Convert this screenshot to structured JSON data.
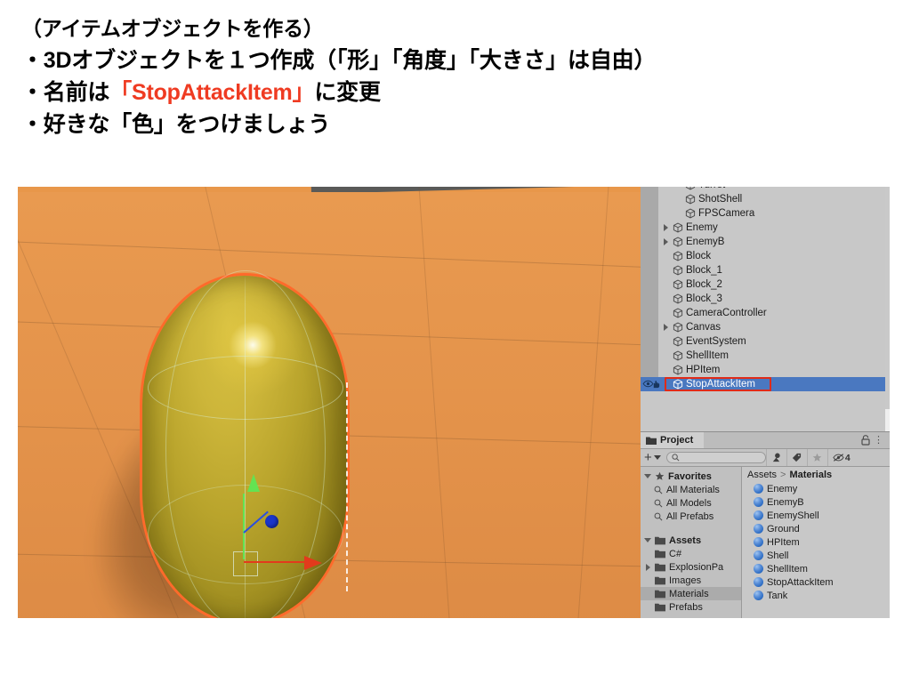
{
  "slide": {
    "lines": [
      "（アイテムオブジェクトを作る）",
      "・3Dオブジェクトを１つ作成（「形」「角度」「大きさ」は自由）"
    ],
    "line3_prefix": "・名前は",
    "line3_highlight": "「StopAttackItem」",
    "line3_suffix": "に変更",
    "line4": "・好きな「色」をつけましょう",
    "highlight_color": "#ef3b22"
  },
  "screenshot": {
    "scene": {
      "background_color": "#e8974a",
      "horizon_color": "#5a5a58",
      "object_color": "#c3b036",
      "selection_outline_color": "#ff6a2b",
      "gizmo": {
        "y_axis_color": "#63e352",
        "x_axis_color": "#e23a1c",
        "z_axis_color": "#2a4fe0"
      }
    },
    "hierarchy": {
      "selection_color": "#4a78c0",
      "annotation_box_color": "#e02b18",
      "items": [
        {
          "label": "Turret",
          "depth": 2,
          "expandable": false,
          "selected": false,
          "clipped": true
        },
        {
          "label": "ShotShell",
          "depth": 2,
          "expandable": false,
          "selected": false
        },
        {
          "label": "FPSCamera",
          "depth": 2,
          "expandable": false,
          "selected": false
        },
        {
          "label": "Enemy",
          "depth": 1,
          "expandable": true,
          "selected": false
        },
        {
          "label": "EnemyB",
          "depth": 1,
          "expandable": true,
          "selected": false
        },
        {
          "label": "Block",
          "depth": 1,
          "expandable": false,
          "selected": false
        },
        {
          "label": "Block_1",
          "depth": 1,
          "expandable": false,
          "selected": false
        },
        {
          "label": "Block_2",
          "depth": 1,
          "expandable": false,
          "selected": false
        },
        {
          "label": "Block_3",
          "depth": 1,
          "expandable": false,
          "selected": false
        },
        {
          "label": "CameraController",
          "depth": 1,
          "expandable": false,
          "selected": false
        },
        {
          "label": "Canvas",
          "depth": 1,
          "expandable": true,
          "selected": false
        },
        {
          "label": "EventSystem",
          "depth": 1,
          "expandable": false,
          "selected": false
        },
        {
          "label": "ShellItem",
          "depth": 1,
          "expandable": false,
          "selected": false
        },
        {
          "label": "HPItem",
          "depth": 1,
          "expandable": false,
          "selected": false
        },
        {
          "label": "StopAttackItem",
          "depth": 1,
          "expandable": false,
          "selected": true
        }
      ]
    },
    "project": {
      "tab_label": "Project",
      "toolbar": {
        "add_label": "+",
        "search_placeholder": "",
        "search_value": "",
        "hidden_count": "4"
      },
      "breadcrumb": {
        "root": "Assets",
        "separator": ">",
        "current": "Materials"
      },
      "tree": [
        {
          "label": "Favorites",
          "type": "header",
          "expanded": true,
          "selected": false
        },
        {
          "label": "All Materials",
          "type": "search",
          "selected": false
        },
        {
          "label": "All Models",
          "type": "search",
          "selected": false
        },
        {
          "label": "All Prefabs",
          "type": "search",
          "selected": false
        },
        {
          "label": "",
          "type": "spacer"
        },
        {
          "label": "Assets",
          "type": "header",
          "expanded": true,
          "selected": false
        },
        {
          "label": "C#",
          "type": "folder",
          "expandable": false,
          "selected": false
        },
        {
          "label": "ExplosionPa",
          "type": "folder",
          "expandable": true,
          "selected": false
        },
        {
          "label": "Images",
          "type": "folder",
          "expandable": false,
          "selected": false
        },
        {
          "label": "Materials",
          "type": "folder",
          "expandable": false,
          "selected": true
        },
        {
          "label": "Prefabs",
          "type": "folder",
          "expandable": false,
          "selected": false
        }
      ],
      "assets": [
        {
          "label": "Enemy",
          "kind": "material"
        },
        {
          "label": "EnemyB",
          "kind": "material"
        },
        {
          "label": "EnemyShell",
          "kind": "material"
        },
        {
          "label": "Ground",
          "kind": "material"
        },
        {
          "label": "HPItem",
          "kind": "material"
        },
        {
          "label": "Shell",
          "kind": "material"
        },
        {
          "label": "ShellItem",
          "kind": "material"
        },
        {
          "label": "StopAttackItem",
          "kind": "material"
        },
        {
          "label": "Tank",
          "kind": "material"
        }
      ]
    }
  }
}
